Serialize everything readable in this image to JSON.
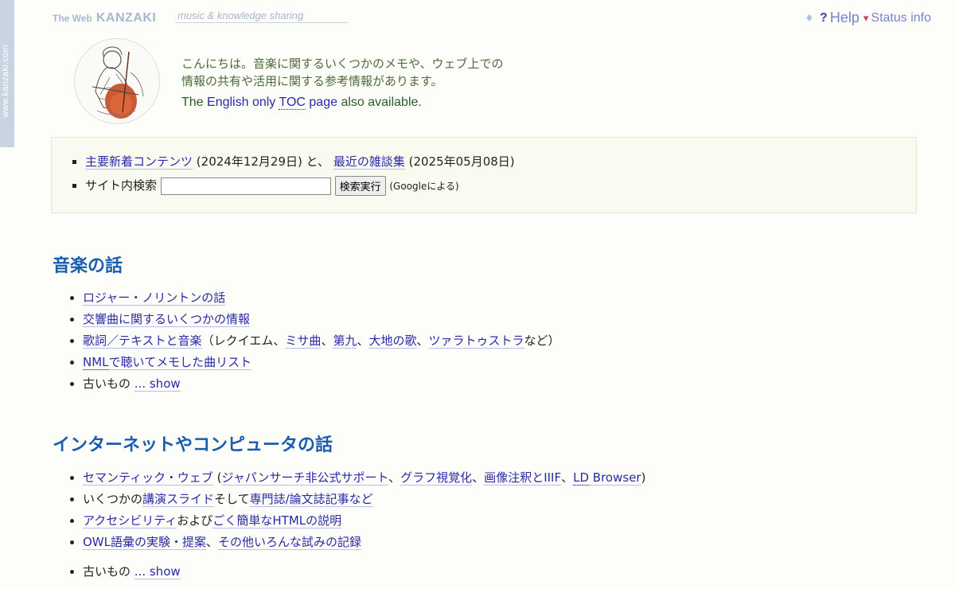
{
  "side_tab": "www.kanzaki.com",
  "brand": {
    "small": "The Web",
    "big": "KANZAKI",
    "tagline": "music & knowledge sharing"
  },
  "topbar": {
    "diamond_icon": "diamond-icon",
    "help_q": "?",
    "help": "Help",
    "status_marker": "▾",
    "status": "Status info"
  },
  "intro": {
    "line1": "こんにちは。音楽に関するいくつかのメモや、ウェブ上での",
    "line2": "情報の共有や活用に関する参考情報があります。",
    "en_the": "The",
    "en_link1": "English only",
    "en_link2": "TOC",
    "en_link3": "page",
    "en_tail": "also available."
  },
  "news": {
    "link1": "主要新着コンテンツ",
    "date1": "(2024年12月29日) と、",
    "link2": "最近の雑談集",
    "date2": "(2025年05月08日)",
    "search_label": "サイト内検索",
    "search_value": "",
    "search_button": "検索実行",
    "search_note": "(Googleによる)"
  },
  "music": {
    "title": "音楽の話",
    "item1": "ロジャー・ノリントンの話",
    "item2": "交響曲に関するいくつかの情報",
    "item3_link": "歌詞／テキストと音楽",
    "item3_a": "（レクイエム、",
    "item3_l2": "ミサ曲",
    "item3_sep1": "、",
    "item3_l3": "第九",
    "item3_sep2": "、",
    "item3_l4": "大地の歌",
    "item3_sep3": "、",
    "item3_l5": "ツァラトゥストラ",
    "item3_tail": "など）",
    "item4_abbr": "NML",
    "item4_rest": "で聴いてメモした曲リスト",
    "item5_text": "古いもの",
    "item5_link": "... show"
  },
  "internet": {
    "title": "インターネットやコンピュータの話",
    "item1_link": "セマンティック・ウェブ",
    "item1_open": " (",
    "item1_l2": "ジャパンサーチ非公式サポート",
    "item1_sep1": "、",
    "item1_l3": "グラフ視覚化",
    "item1_sep2": "、",
    "item1_l4": "画像注釈とIIIF",
    "item1_sep3": "、",
    "item1_l5a": "LD",
    "item1_l5b": " Browser",
    "item1_close": ")",
    "item2_a": "いくつかの",
    "item2_l1": "講演スライド",
    "item2_b": "そして",
    "item2_l2": "専門誌/論文誌記事など",
    "item3_l1": "アクセシビリティ",
    "item3_b": "および",
    "item3_l2": "ごく簡単なHTMLの説明",
    "item4_l1": "OWL語彙の実験・提案",
    "item4_b": "、",
    "item4_l2": "その他いろんな試みの記録",
    "item5_text": "古いもの",
    "item5_link": "... show"
  }
}
